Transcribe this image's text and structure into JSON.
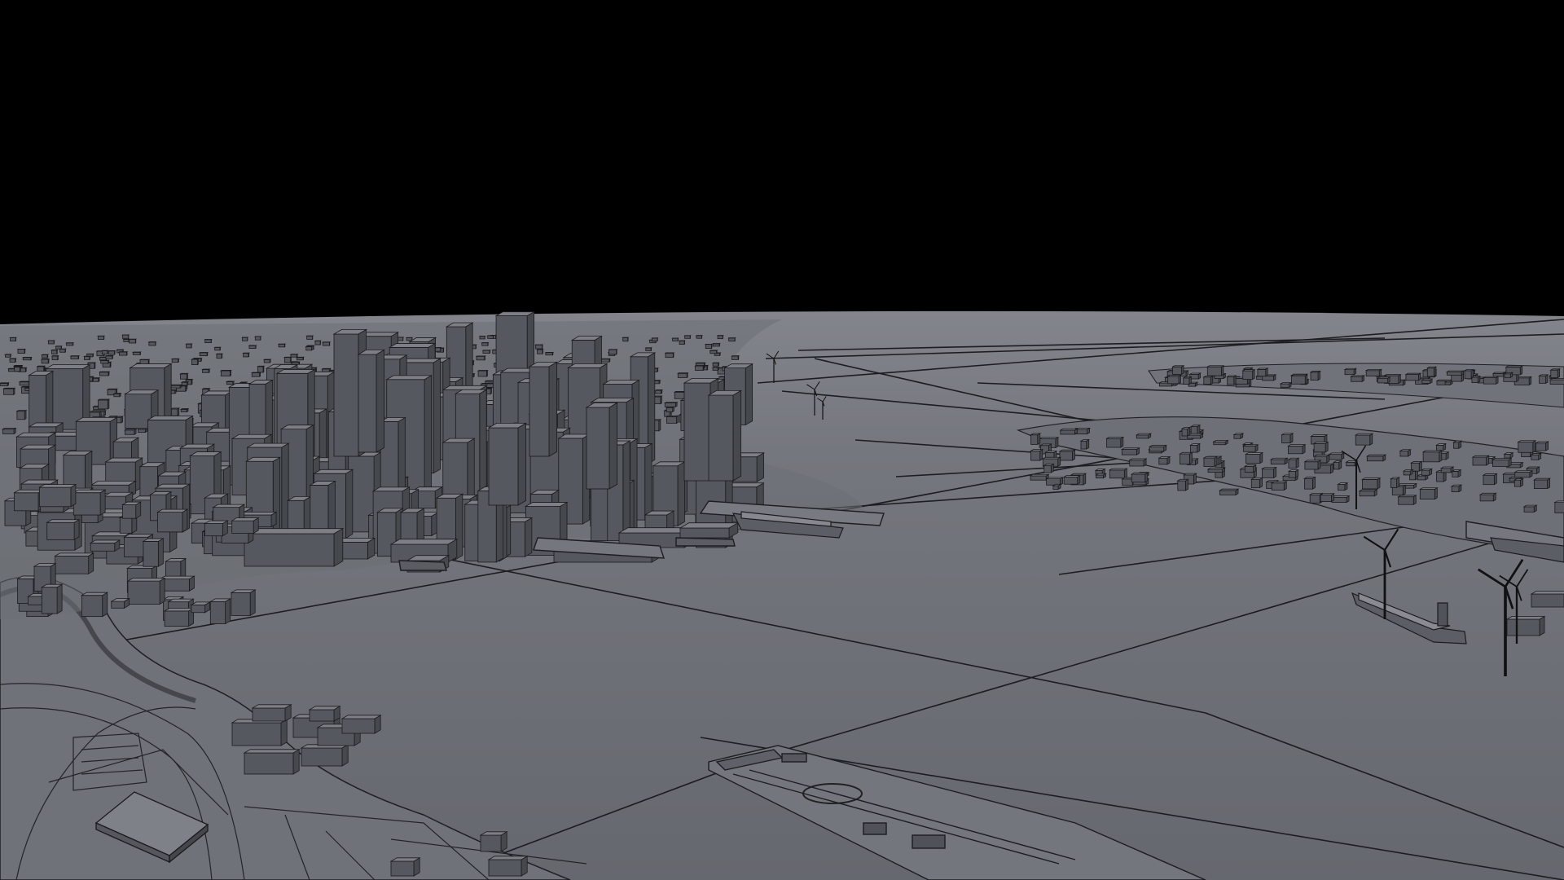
{
  "scene": {
    "description_shown_text": "",
    "colors": {
      "sky": "#000000",
      "ground": "#6b6e74",
      "ground_far": "#7b7e84",
      "line": "#1e1f22",
      "building_top": "#7c7f85",
      "building_left": "#55585e",
      "building_right": "#45484d",
      "edge": "#1a1b1d"
    },
    "layers": [
      "sky",
      "ground-plane",
      "graticule-lines",
      "shoreline",
      "downtown-skyline",
      "east-shore-district",
      "port-piers",
      "cargo-ships",
      "wind-turbines",
      "foreground-terminal"
    ]
  }
}
